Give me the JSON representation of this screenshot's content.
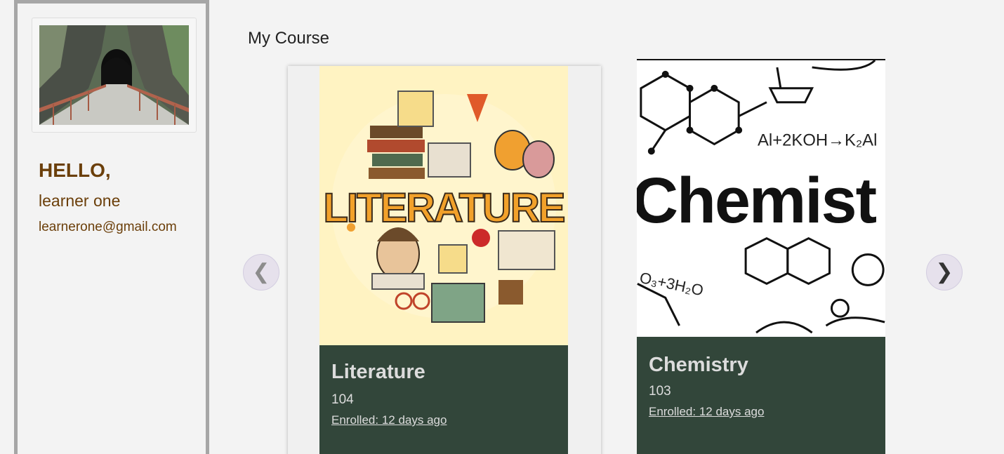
{
  "profile": {
    "greeting": "HELLO,",
    "name": "learner one",
    "email": "learnerone@gmail.com"
  },
  "main": {
    "section_title": "My Course"
  },
  "carousel": {
    "prev_glyph": "❮",
    "next_glyph": "❯"
  },
  "courses": [
    {
      "title": "Literature",
      "code": "104",
      "enrolled": "Enrolled: 12 days ago",
      "image_text": "LITERATURE"
    },
    {
      "title": "Chemistry",
      "code": "103",
      "enrolled": "Enrolled: 12 days ago",
      "image_text": "Chemist",
      "image_formula_1": "Al+2KOH→K₂Al",
      "image_formula_2": "O₃+3H₂O"
    }
  ],
  "colors": {
    "accent_brown": "#6b3f0a",
    "card_footer": "#32463a",
    "page_bg": "#f3f3f3"
  }
}
